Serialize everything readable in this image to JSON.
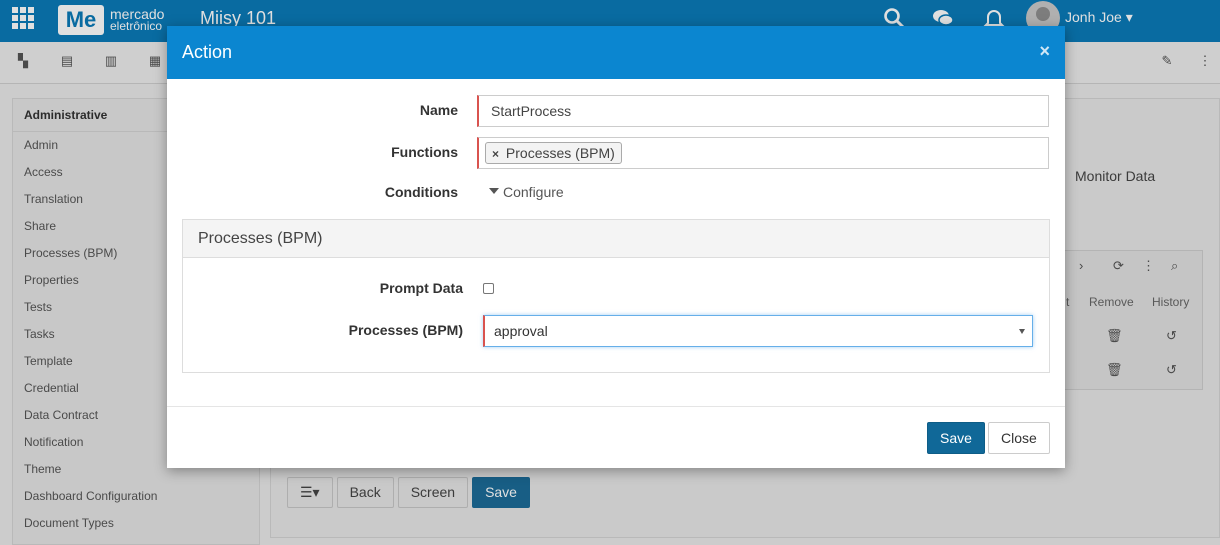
{
  "app": {
    "brand_main": "mercado",
    "brand_sub": "eletrônico",
    "brand_mark": "Me",
    "title": "Miisy 101",
    "user_name": "Jonh Joe ▾"
  },
  "sidebar": {
    "heading": "Administrative",
    "items": [
      {
        "label": "Admin"
      },
      {
        "label": "Access"
      },
      {
        "label": "Translation"
      },
      {
        "label": "Share"
      },
      {
        "label": "Processes (BPM)"
      },
      {
        "label": "Properties"
      },
      {
        "label": "Tests"
      },
      {
        "label": "Tasks"
      },
      {
        "label": "Template"
      },
      {
        "label": "Credential"
      },
      {
        "label": "Data Contract"
      },
      {
        "label": "Notification"
      },
      {
        "label": "Theme"
      },
      {
        "label": "Dashboard Configuration"
      },
      {
        "label": "Document Types"
      }
    ]
  },
  "background": {
    "monitor_data": "Monitor Data",
    "col_partial": "t",
    "col_remove": "Remove",
    "col_history": "History",
    "footer_back": "Back",
    "footer_screen": "Screen",
    "footer_save": "Save"
  },
  "modal": {
    "title": "Action",
    "close_glyph": "×",
    "name_label": "Name",
    "name_value": "StartProcess",
    "functions_label": "Functions",
    "functions_tag": "Processes (BPM)",
    "functions_tag_remove": "×",
    "conditions_label": "Conditions",
    "configure_label": "Configure",
    "panel_title": "Processes (BPM)",
    "prompt_label": "Prompt Data",
    "prompt_checked": false,
    "bpm_label": "Processes (BPM)",
    "bpm_value": "approval",
    "save_label": "Save",
    "close_label": "Close"
  },
  "icons": {
    "apps": "apps-grid-icon",
    "search": "search-icon",
    "chat": "chat-icon",
    "bell": "bell-icon"
  },
  "colors": {
    "topbar": "#0b7ab8",
    "modal_header": "#0b86d0",
    "primary_button": "#106898",
    "required_marker": "#d9534f"
  }
}
